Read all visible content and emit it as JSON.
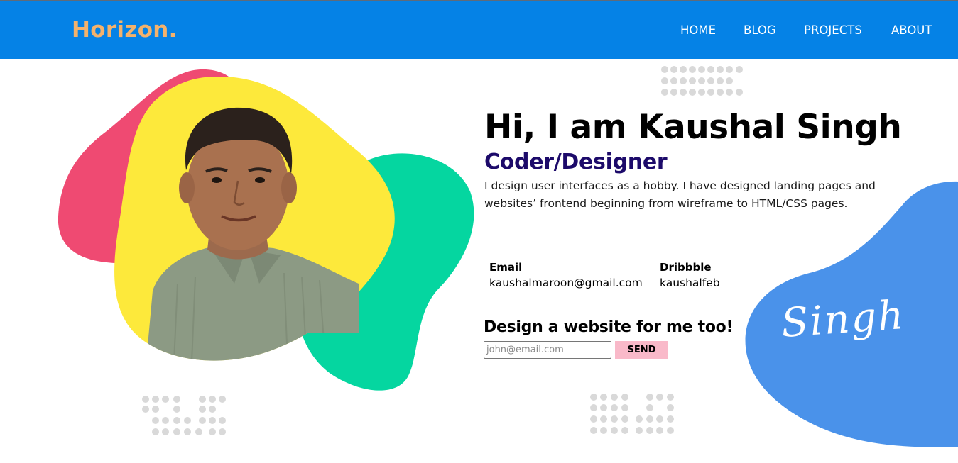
{
  "header": {
    "brand": "Horizon.",
    "nav": [
      {
        "label": "HOME"
      },
      {
        "label": "BLOG"
      },
      {
        "label": "PROJECTS"
      },
      {
        "label": "ABOUT"
      }
    ]
  },
  "hero": {
    "title": "Hi, I am Kaushal Singh",
    "role": "Coder/Designer",
    "description": "I design user interfaces as a hobby. I have designed landing pages and websites’ frontend beginning from wireframe to HTML/CSS pages."
  },
  "contact": {
    "email_label": "Email",
    "email_value": "kaushalmaroon@gmail.com",
    "dribbble_label": "Dribbble",
    "dribbble_value": "kaushalfeb"
  },
  "cta": {
    "heading": "Design a website for me too!",
    "input_placeholder": "john@email.com",
    "input_value": "",
    "button_label": "SEND"
  },
  "signature": "Singh",
  "colors": {
    "navbar": "#0582e6",
    "brand": "#f4b26c",
    "pink_blob": "#ef4a72",
    "yellow_blob": "#fde93b",
    "green_blob": "#05d6a0",
    "blue_blob": "#4a92ea",
    "role_text": "#1c0a6a",
    "send_button": "#f9b9c9",
    "dots": "#d9d9d9"
  },
  "icons": {
    "profile_photo": "person-portrait"
  }
}
